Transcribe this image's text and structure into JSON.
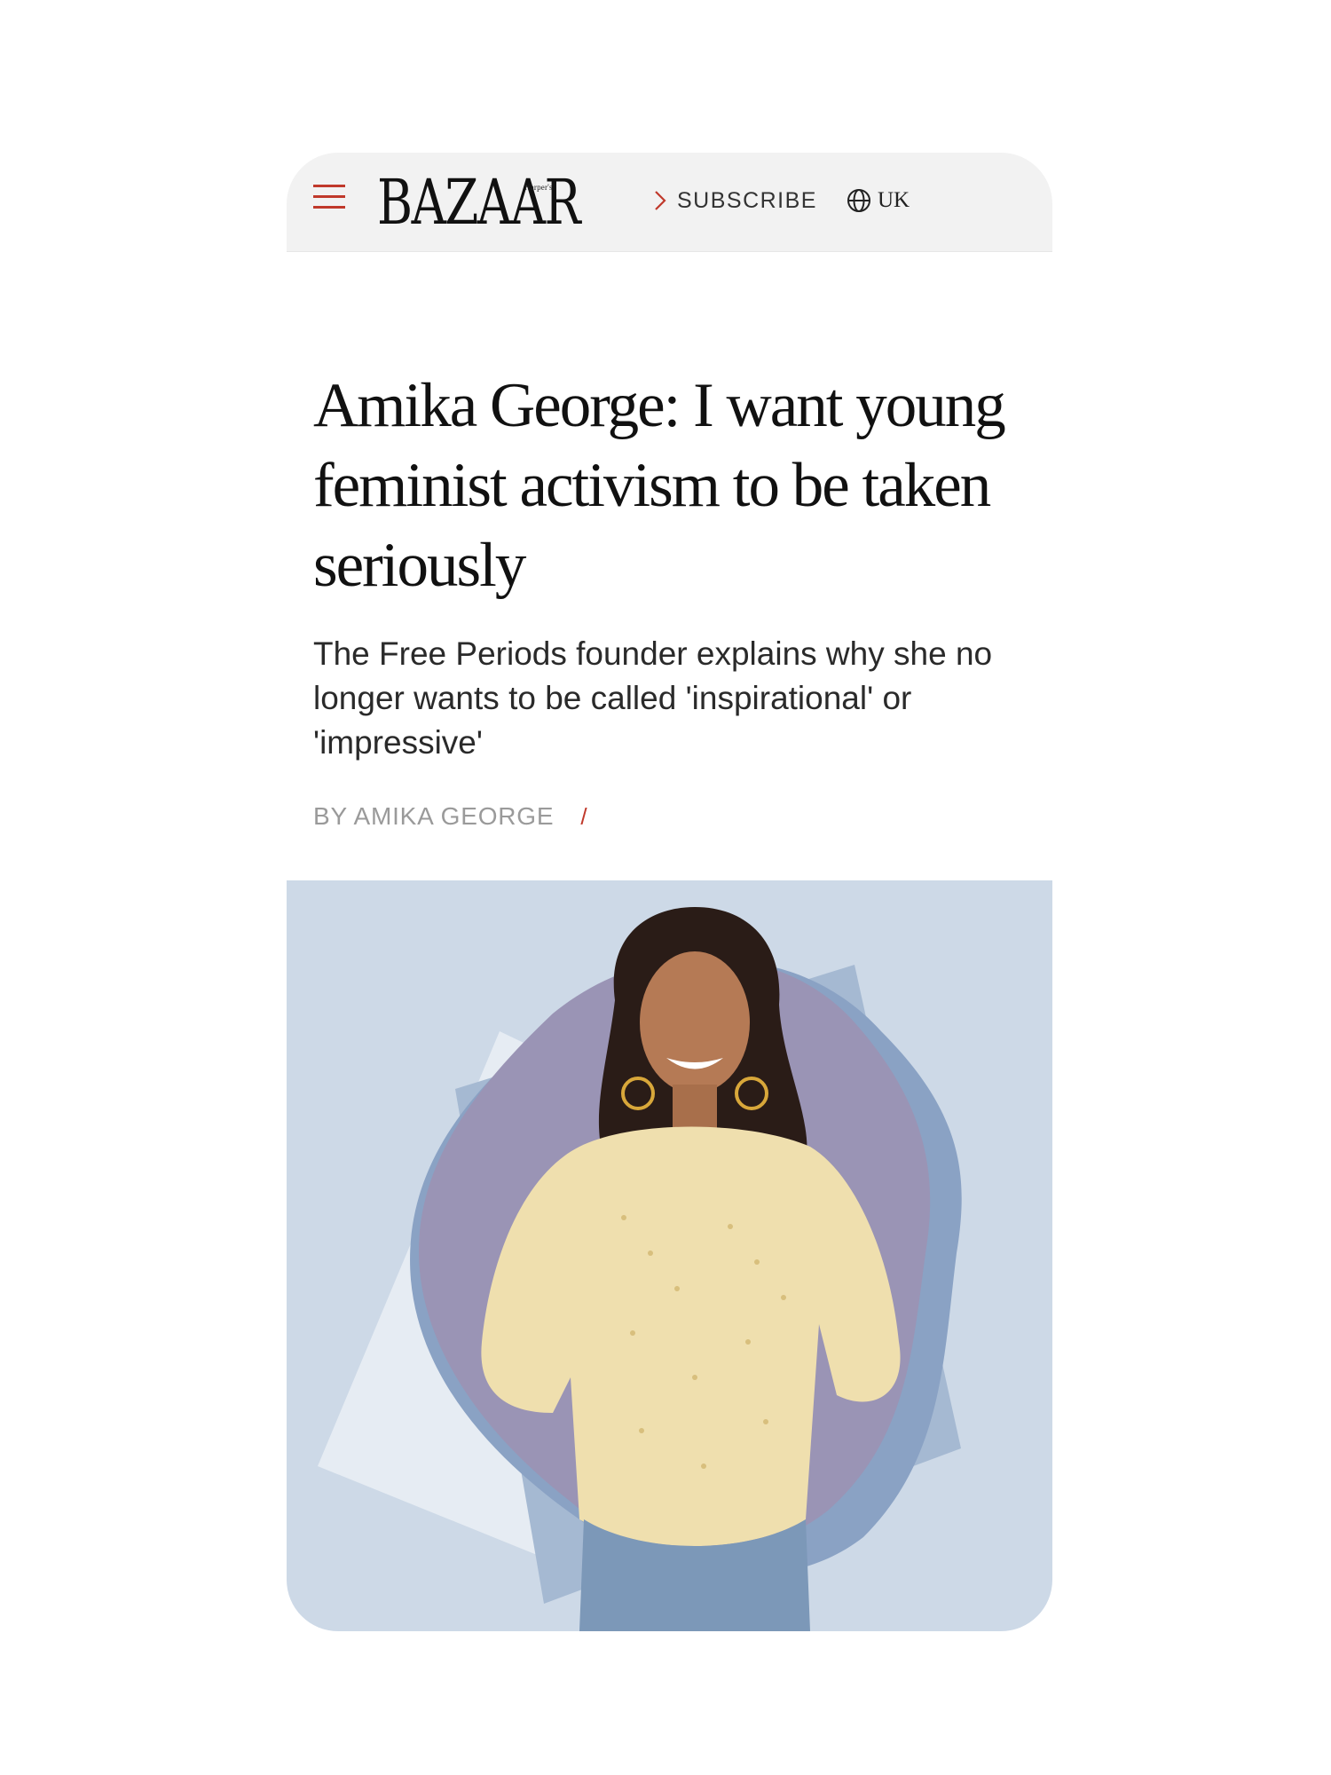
{
  "header": {
    "logo_small": "Harper's",
    "logo_text": "BAZAAR",
    "subscribe_label": "SUBSCRIBE",
    "region_label": "UK",
    "menu_icon": "hamburger-menu-icon",
    "subscribe_icon": "chevron-right-icon",
    "region_icon": "globe-icon"
  },
  "article": {
    "headline": "Amika George: I want young feminist activism to be taken seriously",
    "dek": "The Free Periods founder explains why she no longer wants to be called 'inspirational' or 'impressive'",
    "byline": "BY AMIKA GEORGE",
    "byline_separator": "/"
  },
  "colors": {
    "accent": "#c0392b",
    "header_bg": "#f2f2f2",
    "hero_bg": "#cdd9e7"
  }
}
